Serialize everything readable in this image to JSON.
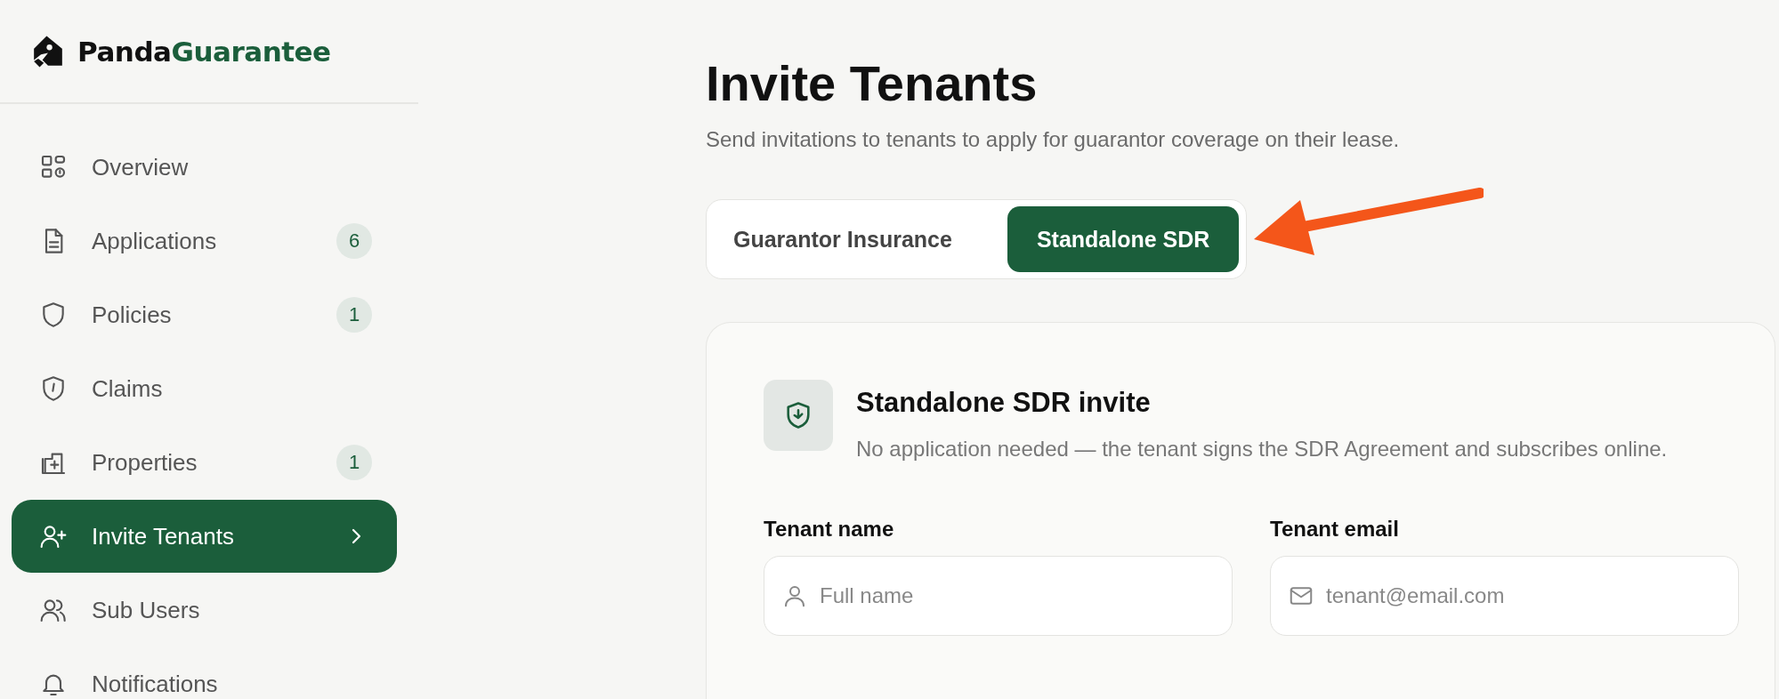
{
  "brand": {
    "part_1": "Panda",
    "part_2": "Guarantee"
  },
  "sidebar": {
    "items": [
      {
        "label": "Overview",
        "selected": false
      },
      {
        "label": "Applications",
        "badge": "6",
        "selected": false
      },
      {
        "label": "Policies",
        "badge": "1",
        "selected": false
      },
      {
        "label": "Claims",
        "selected": false
      },
      {
        "label": "Properties",
        "badge": "1",
        "selected": false
      },
      {
        "label": "Invite Tenants",
        "selected": true
      },
      {
        "label": "Sub Users",
        "selected": false
      },
      {
        "label": "Notifications",
        "selected": false
      }
    ]
  },
  "page": {
    "title": "Invite Tenants",
    "subtitle": "Send invitations to tenants to apply for guarantor coverage on their lease."
  },
  "tabs": [
    {
      "label": "Guarantor Insurance",
      "selected": false
    },
    {
      "label": "Standalone SDR",
      "selected": true
    }
  ],
  "card": {
    "title": "Standalone SDR invite",
    "description": "No application needed — the tenant signs the SDR Agreement and subscribes online.",
    "fields": [
      {
        "label": "Tenant name",
        "placeholder": "Full name"
      },
      {
        "label": "Tenant email",
        "placeholder": "tenant@email.com"
      }
    ]
  }
}
